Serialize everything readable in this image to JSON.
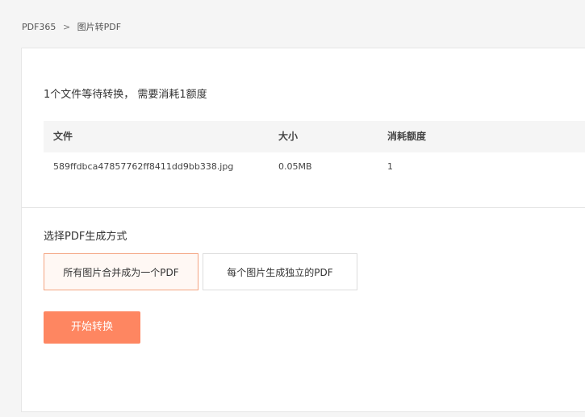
{
  "breadcrumb": {
    "home": "PDF365",
    "separator": ">",
    "current": "图片转PDF"
  },
  "summary": {
    "text": "1个文件等待转换， 需要消耗1额度"
  },
  "file_table": {
    "headers": [
      "文件",
      "大小",
      "消耗额度"
    ],
    "rows": [
      [
        "589ffdbca47857762ff8411dd9bb338.jpg",
        "0.05MB",
        "1"
      ]
    ]
  },
  "mode": {
    "title": "选择PDF生成方式",
    "options": [
      {
        "label": "所有图片合并成为一个PDF",
        "selected": true
      },
      {
        "label": "每个图片生成独立的PDF",
        "selected": false
      }
    ]
  },
  "actions": {
    "start_label": "开始转换"
  },
  "colors": {
    "accent": "#fe8661",
    "selected_border": "#f4a582",
    "selected_background": "#fff8f4",
    "page_background": "#f5f5f5"
  }
}
